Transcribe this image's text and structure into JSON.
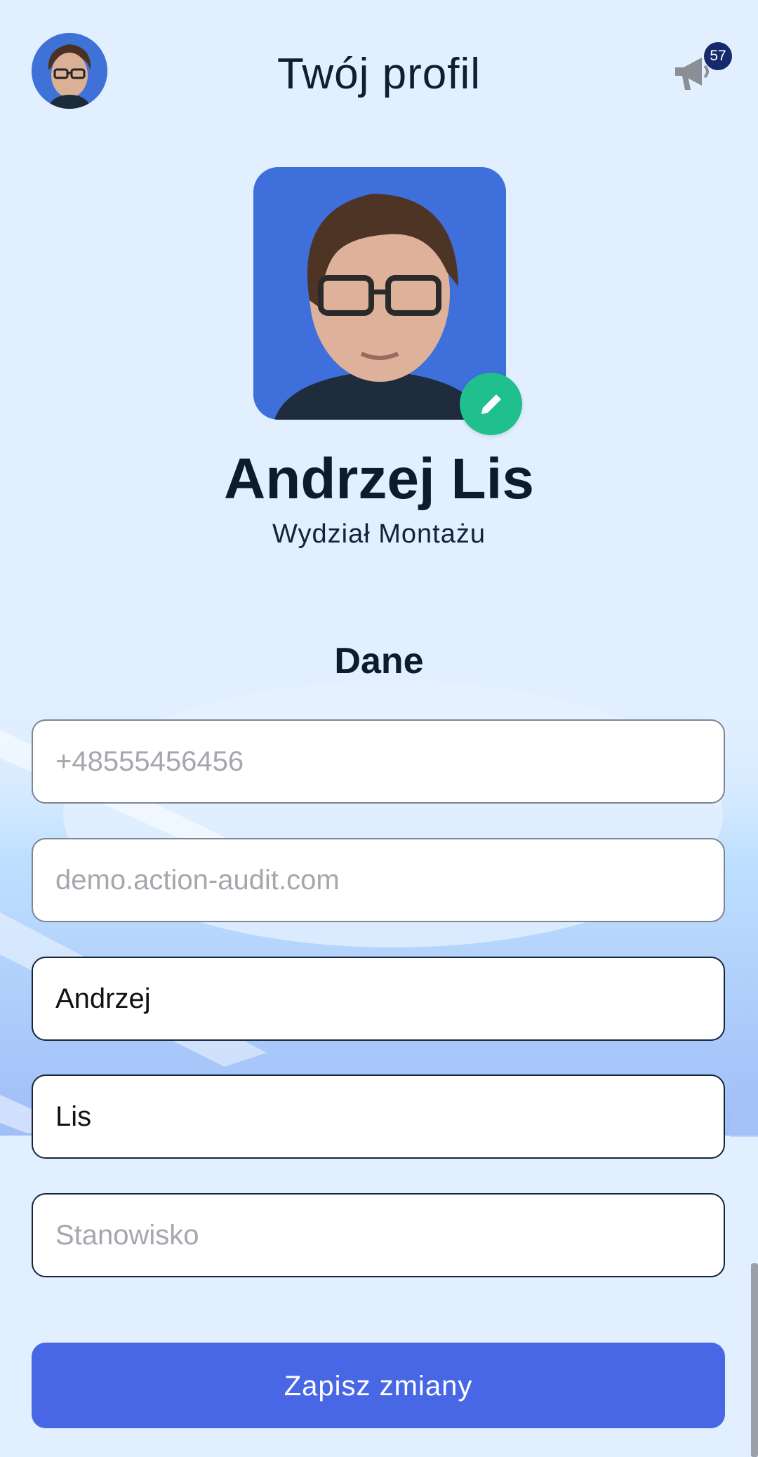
{
  "header": {
    "title": "Twój profil",
    "notification_count": "57",
    "notification_icon": "megaphone-icon"
  },
  "profile": {
    "name": "Andrzej Lis",
    "department": "Wydział Montażu",
    "edit_icon": "pencil-icon"
  },
  "form": {
    "section_title": "Dane",
    "phone": {
      "placeholder": "+48555456456",
      "value": ""
    },
    "domain": {
      "placeholder": "demo.action-audit.com",
      "value": ""
    },
    "first_name": {
      "placeholder": "",
      "value": "Andrzej"
    },
    "last_name": {
      "placeholder": "",
      "value": "Lis"
    },
    "position": {
      "placeholder": "Stanowisko",
      "value": ""
    },
    "save_label": "Zapisz zmiany"
  },
  "colors": {
    "accent": "#4767e5",
    "edit_button": "#1fc08e",
    "badge": "#16296a",
    "background": "#e1efff"
  }
}
